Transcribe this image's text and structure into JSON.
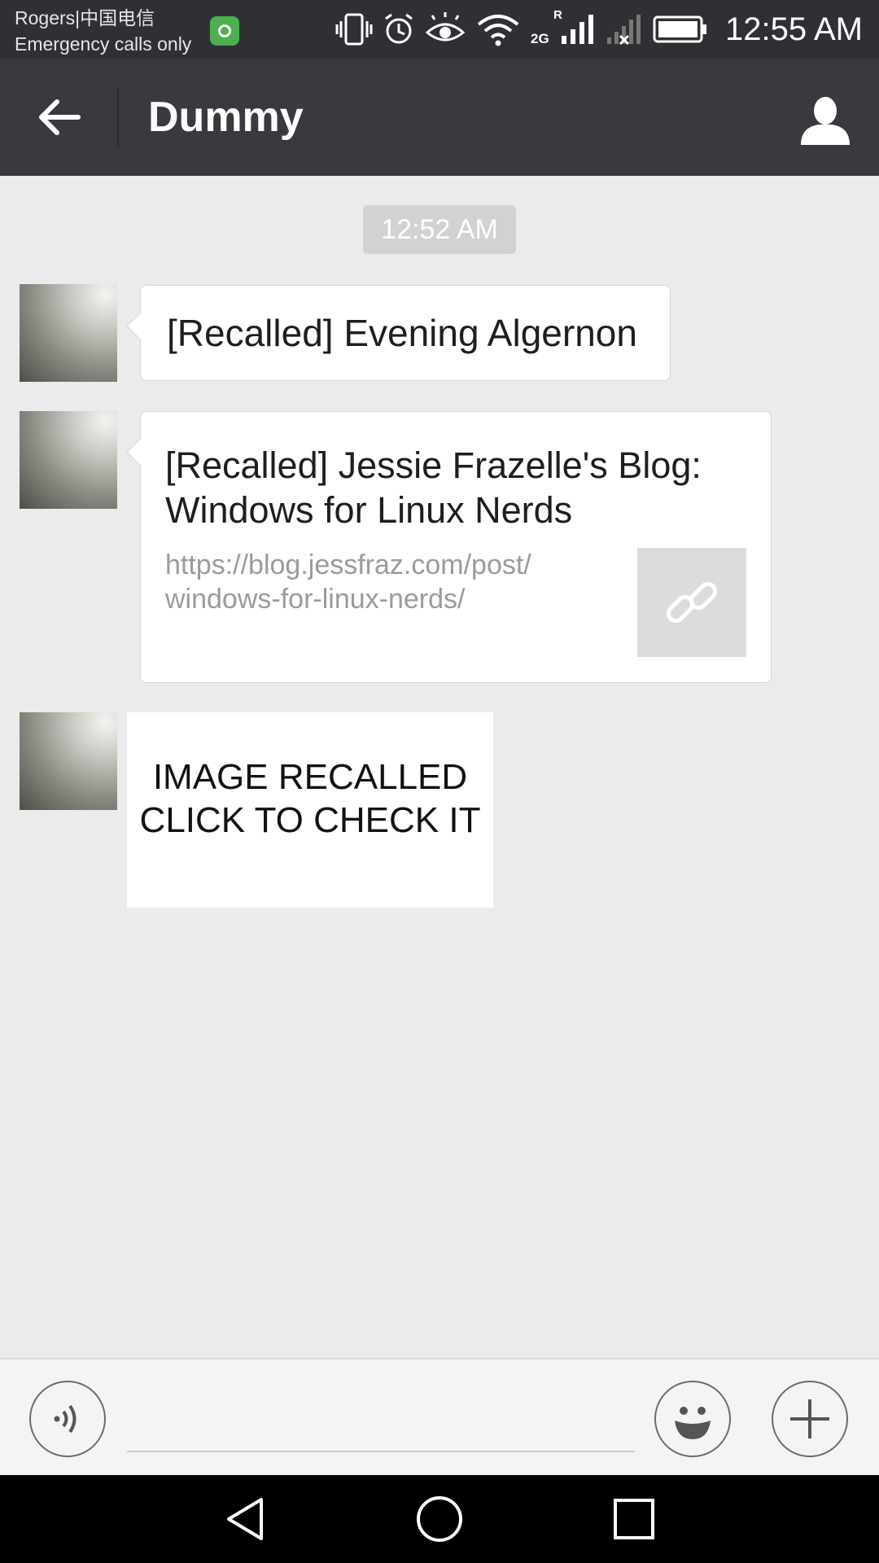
{
  "status_bar": {
    "carrier_line1": "Rogers|中国电信",
    "carrier_line2": "Emergency calls only",
    "network_label": "2G",
    "roaming_label": "R",
    "time": "12:55 AM",
    "icons": [
      "vibrate-icon",
      "alarm-icon",
      "eye-comfort-icon",
      "wifi-icon",
      "signal-icon",
      "no-signal-icon",
      "battery-icon"
    ]
  },
  "header": {
    "title": "Dummy",
    "back_icon": "arrow-left-icon",
    "profile_icon": "person-icon"
  },
  "chat": {
    "timestamp": "12:52 AM",
    "messages": [
      {
        "type": "text",
        "text": "[Recalled] Evening Algernon"
      },
      {
        "type": "link",
        "title": "[Recalled] Jessie Frazelle's Blog: Windows for Linux Nerds",
        "url": "https://blog.jessfraz.com/post/\nwindows-for-linux-nerds/",
        "thumb_icon": "link-icon"
      },
      {
        "type": "image",
        "caption": "IMAGE RECALLED\nCLICK TO CHECK IT"
      }
    ]
  },
  "input_bar": {
    "voice_icon": "voice-icon",
    "emoji_icon": "emoji-icon",
    "plus_icon": "plus-icon",
    "placeholder": ""
  },
  "nav_bar": {
    "back_icon": "nav-back-icon",
    "home_icon": "nav-home-icon",
    "recents_icon": "nav-recents-icon"
  },
  "colors": {
    "status_bar_bg": "#2f3034",
    "title_bar_bg": "#393a3f",
    "chat_bg": "#ebebeb",
    "bubble_bg": "#ffffff",
    "url_text": "#9b9b9b"
  }
}
